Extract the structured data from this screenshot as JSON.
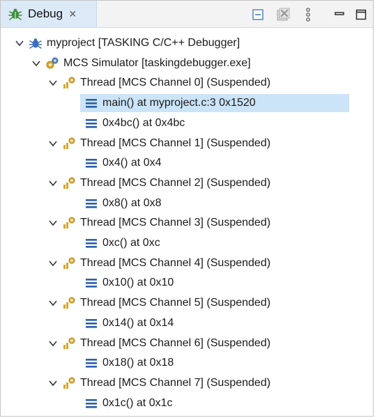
{
  "view": {
    "tab_label": "Debug",
    "close_glyph": "×",
    "toolbar": [
      "collapse-all-icon",
      "remove-terminated-icon",
      "view-menu-icon",
      "minimize-icon",
      "maximize-icon"
    ]
  },
  "tree": {
    "project": {
      "label": "myproject [TASKING C/C++ Debugger]"
    },
    "simulator": {
      "label": "MCS Simulator [taskingdebugger.exe]"
    },
    "threads": [
      {
        "label": "Thread [MCS Channel 0] (Suspended)",
        "frames": [
          "main() at myproject.c:3 0x1520",
          "0x4bc() at 0x4bc"
        ]
      },
      {
        "label": "Thread [MCS Channel 1] (Suspended)",
        "frames": [
          "0x4() at 0x4"
        ]
      },
      {
        "label": "Thread [MCS Channel 2] (Suspended)",
        "frames": [
          "0x8() at 0x8"
        ]
      },
      {
        "label": "Thread [MCS Channel 3] (Suspended)",
        "frames": [
          "0xc() at 0xc"
        ]
      },
      {
        "label": "Thread [MCS Channel 4] (Suspended)",
        "frames": [
          "0x10() at 0x10"
        ]
      },
      {
        "label": "Thread [MCS Channel 5] (Suspended)",
        "frames": [
          "0x14() at 0x14"
        ]
      },
      {
        "label": "Thread [MCS Channel 6] (Suspended)",
        "frames": [
          "0x18() at 0x18"
        ]
      },
      {
        "label": "Thread [MCS Channel 7] (Suspended)",
        "frames": [
          "0x1c() at 0x1c"
        ]
      }
    ],
    "selected_frame": "main() at myproject.c:3 0x1520"
  },
  "colors": {
    "tab_active": "#dce9f7",
    "selection": "#cce4f7",
    "frame_icon": "#2b5ea7",
    "thread_icon": "#d9a52a"
  }
}
